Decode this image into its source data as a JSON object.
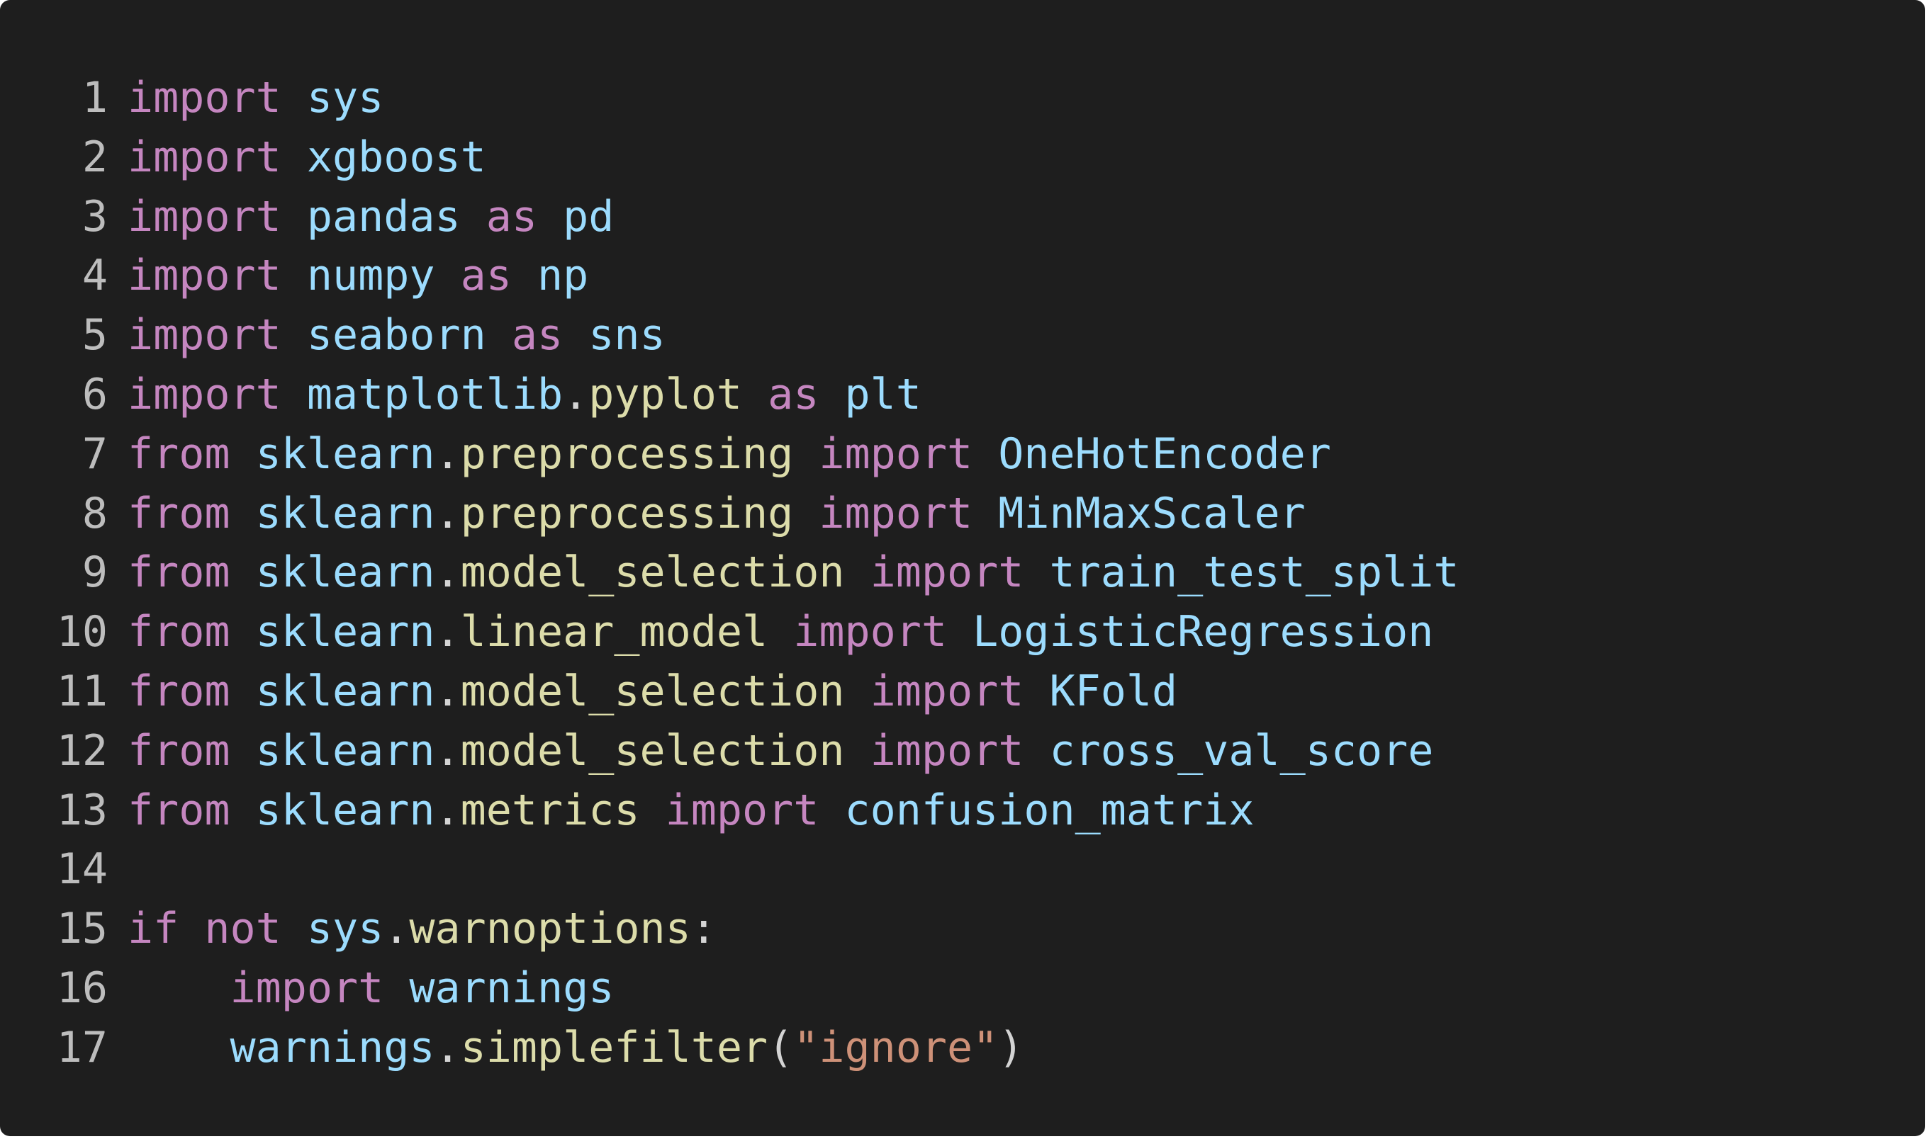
{
  "colors": {
    "background": "#1e1e1e",
    "line_number": "#bdbdbd",
    "keyword": "#c586c0",
    "module": "#9cdcfe",
    "function": "#dcdcaa",
    "string": "#ce9178",
    "punctuation": "#d4d4d4"
  },
  "lines": [
    {
      "number": "1",
      "tokens": [
        {
          "t": "keyword",
          "v": "import"
        },
        {
          "t": "plain",
          "v": " "
        },
        {
          "t": "module",
          "v": "sys"
        }
      ]
    },
    {
      "number": "2",
      "tokens": [
        {
          "t": "keyword",
          "v": "import"
        },
        {
          "t": "plain",
          "v": " "
        },
        {
          "t": "module",
          "v": "xgboost"
        }
      ]
    },
    {
      "number": "3",
      "tokens": [
        {
          "t": "keyword",
          "v": "import"
        },
        {
          "t": "plain",
          "v": " "
        },
        {
          "t": "module",
          "v": "pandas"
        },
        {
          "t": "plain",
          "v": " "
        },
        {
          "t": "keyword",
          "v": "as"
        },
        {
          "t": "plain",
          "v": " "
        },
        {
          "t": "module",
          "v": "pd"
        }
      ]
    },
    {
      "number": "4",
      "tokens": [
        {
          "t": "keyword",
          "v": "import"
        },
        {
          "t": "plain",
          "v": " "
        },
        {
          "t": "module",
          "v": "numpy"
        },
        {
          "t": "plain",
          "v": " "
        },
        {
          "t": "keyword",
          "v": "as"
        },
        {
          "t": "plain",
          "v": " "
        },
        {
          "t": "module",
          "v": "np"
        }
      ]
    },
    {
      "number": "5",
      "tokens": [
        {
          "t": "keyword",
          "v": "import"
        },
        {
          "t": "plain",
          "v": " "
        },
        {
          "t": "module",
          "v": "seaborn"
        },
        {
          "t": "plain",
          "v": " "
        },
        {
          "t": "keyword",
          "v": "as"
        },
        {
          "t": "plain",
          "v": " "
        },
        {
          "t": "module",
          "v": "sns"
        }
      ]
    },
    {
      "number": "6",
      "tokens": [
        {
          "t": "keyword",
          "v": "import"
        },
        {
          "t": "plain",
          "v": " "
        },
        {
          "t": "module",
          "v": "matplotlib"
        },
        {
          "t": "punct",
          "v": "."
        },
        {
          "t": "func",
          "v": "pyplot"
        },
        {
          "t": "plain",
          "v": " "
        },
        {
          "t": "keyword",
          "v": "as"
        },
        {
          "t": "plain",
          "v": " "
        },
        {
          "t": "module",
          "v": "plt"
        }
      ]
    },
    {
      "number": "7",
      "tokens": [
        {
          "t": "keyword",
          "v": "from"
        },
        {
          "t": "plain",
          "v": " "
        },
        {
          "t": "module",
          "v": "sklearn"
        },
        {
          "t": "punct",
          "v": "."
        },
        {
          "t": "func",
          "v": "preprocessing"
        },
        {
          "t": "plain",
          "v": " "
        },
        {
          "t": "keyword",
          "v": "import"
        },
        {
          "t": "plain",
          "v": " "
        },
        {
          "t": "module",
          "v": "OneHotEncoder"
        }
      ]
    },
    {
      "number": "8",
      "tokens": [
        {
          "t": "keyword",
          "v": "from"
        },
        {
          "t": "plain",
          "v": " "
        },
        {
          "t": "module",
          "v": "sklearn"
        },
        {
          "t": "punct",
          "v": "."
        },
        {
          "t": "func",
          "v": "preprocessing"
        },
        {
          "t": "plain",
          "v": " "
        },
        {
          "t": "keyword",
          "v": "import"
        },
        {
          "t": "plain",
          "v": " "
        },
        {
          "t": "module",
          "v": "MinMaxScaler"
        }
      ]
    },
    {
      "number": "9",
      "tokens": [
        {
          "t": "keyword",
          "v": "from"
        },
        {
          "t": "plain",
          "v": " "
        },
        {
          "t": "module",
          "v": "sklearn"
        },
        {
          "t": "punct",
          "v": "."
        },
        {
          "t": "func",
          "v": "model_selection"
        },
        {
          "t": "plain",
          "v": " "
        },
        {
          "t": "keyword",
          "v": "import"
        },
        {
          "t": "plain",
          "v": " "
        },
        {
          "t": "module",
          "v": "train_test_split"
        }
      ]
    },
    {
      "number": "10",
      "tokens": [
        {
          "t": "keyword",
          "v": "from"
        },
        {
          "t": "plain",
          "v": " "
        },
        {
          "t": "module",
          "v": "sklearn"
        },
        {
          "t": "punct",
          "v": "."
        },
        {
          "t": "func",
          "v": "linear_model"
        },
        {
          "t": "plain",
          "v": " "
        },
        {
          "t": "keyword",
          "v": "import"
        },
        {
          "t": "plain",
          "v": " "
        },
        {
          "t": "module",
          "v": "LogisticRegression"
        }
      ]
    },
    {
      "number": "11",
      "tokens": [
        {
          "t": "keyword",
          "v": "from"
        },
        {
          "t": "plain",
          "v": " "
        },
        {
          "t": "module",
          "v": "sklearn"
        },
        {
          "t": "punct",
          "v": "."
        },
        {
          "t": "func",
          "v": "model_selection"
        },
        {
          "t": "plain",
          "v": " "
        },
        {
          "t": "keyword",
          "v": "import"
        },
        {
          "t": "plain",
          "v": " "
        },
        {
          "t": "module",
          "v": "KFold"
        }
      ]
    },
    {
      "number": "12",
      "tokens": [
        {
          "t": "keyword",
          "v": "from"
        },
        {
          "t": "plain",
          "v": " "
        },
        {
          "t": "module",
          "v": "sklearn"
        },
        {
          "t": "punct",
          "v": "."
        },
        {
          "t": "func",
          "v": "model_selection"
        },
        {
          "t": "plain",
          "v": " "
        },
        {
          "t": "keyword",
          "v": "import"
        },
        {
          "t": "plain",
          "v": " "
        },
        {
          "t": "module",
          "v": "cross_val_score"
        }
      ]
    },
    {
      "number": "13",
      "tokens": [
        {
          "t": "keyword",
          "v": "from"
        },
        {
          "t": "plain",
          "v": " "
        },
        {
          "t": "module",
          "v": "sklearn"
        },
        {
          "t": "punct",
          "v": "."
        },
        {
          "t": "func",
          "v": "metrics"
        },
        {
          "t": "plain",
          "v": " "
        },
        {
          "t": "keyword",
          "v": "import"
        },
        {
          "t": "plain",
          "v": " "
        },
        {
          "t": "module",
          "v": "confusion_matrix"
        }
      ]
    },
    {
      "number": "14",
      "tokens": []
    },
    {
      "number": "15",
      "tokens": [
        {
          "t": "keyword",
          "v": "if"
        },
        {
          "t": "plain",
          "v": " "
        },
        {
          "t": "keyword",
          "v": "not"
        },
        {
          "t": "plain",
          "v": " "
        },
        {
          "t": "module",
          "v": "sys"
        },
        {
          "t": "punct",
          "v": "."
        },
        {
          "t": "func",
          "v": "warnoptions"
        },
        {
          "t": "punct",
          "v": ":"
        }
      ]
    },
    {
      "number": "16",
      "tokens": [
        {
          "t": "plain",
          "v": "    "
        },
        {
          "t": "keyword",
          "v": "import"
        },
        {
          "t": "plain",
          "v": " "
        },
        {
          "t": "module",
          "v": "warnings"
        }
      ]
    },
    {
      "number": "17",
      "tokens": [
        {
          "t": "plain",
          "v": "    "
        },
        {
          "t": "module",
          "v": "warnings"
        },
        {
          "t": "punct",
          "v": "."
        },
        {
          "t": "func",
          "v": "simplefilter"
        },
        {
          "t": "punct",
          "v": "("
        },
        {
          "t": "string",
          "v": "\"ignore\""
        },
        {
          "t": "punct",
          "v": ")"
        }
      ]
    }
  ]
}
